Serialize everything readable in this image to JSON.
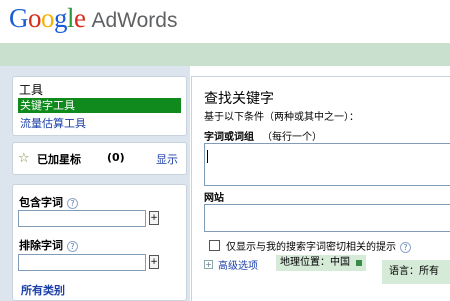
{
  "brand": {
    "google_letters": [
      "G",
      "o",
      "o",
      "g",
      "l",
      "e"
    ],
    "product": "AdWords"
  },
  "sidebar": {
    "tools": {
      "title": "工具",
      "items": [
        {
          "label": "关键字工具",
          "active": true
        },
        {
          "label": "流量估算工具",
          "active": false
        }
      ]
    },
    "starred": {
      "label": "已加星标",
      "count": "(0)",
      "show_link": "显示"
    },
    "filters": {
      "include_label": "包含字词",
      "exclude_label": "排除字词",
      "help": "?",
      "add": "+",
      "all_categories": "所有类别"
    }
  },
  "main": {
    "title": "查找关键字",
    "subtitle": "基于以下条件（两种或其中之一）：",
    "words_label": "字词或词组",
    "words_hint": "（每行一个）",
    "words_value": "",
    "site_label": "网站",
    "site_value": "",
    "checkbox_label": "仅显示与我的搜索字词密切相关的提示",
    "checkbox_checked": false,
    "advanced": "高级选项",
    "geo": "地理位置：中国",
    "language": "语言：所有"
  },
  "colors": {
    "accent_green": "#108a1d",
    "header_band": "#c9e0cf",
    "sidebar_bg": "#dce4ee",
    "link": "#1b3fa8"
  }
}
